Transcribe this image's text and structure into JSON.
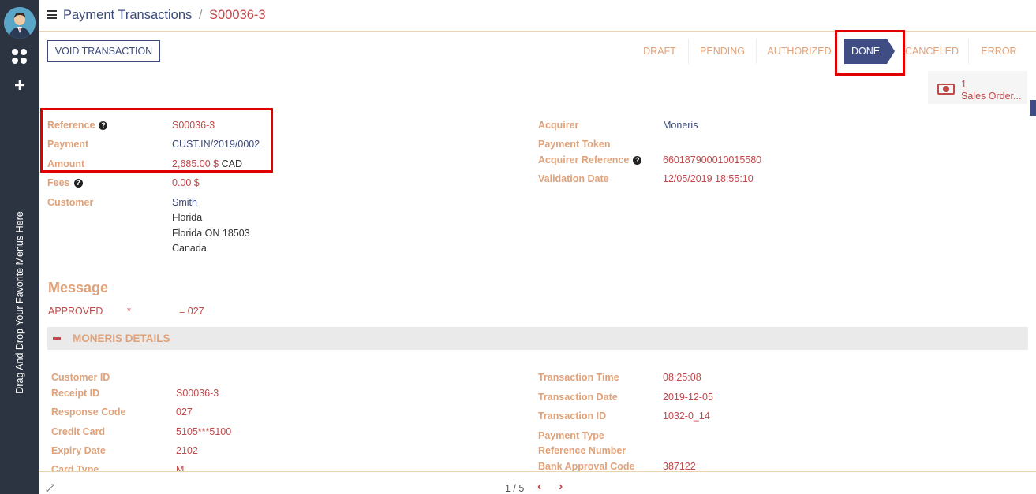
{
  "sidebar": {
    "favorite_hint": "Drag And Drop Your Favorite Menus Here"
  },
  "breadcrumb": {
    "parent": "Payment Transactions",
    "separator": "/",
    "current": "S00036-3"
  },
  "actions": {
    "void_label": "VOID TRANSACTION"
  },
  "status": {
    "stages": [
      "DRAFT",
      "PENDING",
      "AUTHORIZED",
      "DONE",
      "CANCELED",
      "ERROR"
    ],
    "active": "DONE"
  },
  "smart_button": {
    "count": "1",
    "label": "Sales Order..."
  },
  "fields_left": {
    "reference_label": "Reference",
    "reference_value": "S00036-3",
    "payment_label": "Payment",
    "payment_value": "CUST.IN/2019/0002",
    "amount_label": "Amount",
    "amount_value": "2,685.00 $",
    "amount_currency": "CAD",
    "fees_label": "Fees",
    "fees_value": "0.00 $",
    "customer_label": "Customer",
    "customer_name": "Smith",
    "customer_line1": "Florida",
    "customer_line2": "Florida ON 18503",
    "customer_line3": "Canada"
  },
  "fields_right": {
    "acquirer_label": "Acquirer",
    "acquirer_value": "Moneris",
    "payment_token_label": "Payment Token",
    "acquirer_reference_label": "Acquirer Reference",
    "acquirer_reference_value": "660187900010015580",
    "validation_date_label": "Validation Date",
    "validation_date_value": "12/05/2019 18:55:10"
  },
  "message": {
    "title": "Message",
    "status": "APPROVED",
    "star": "*",
    "code": "= 027"
  },
  "moneris": {
    "title": "MONERIS DETAILS",
    "left": [
      {
        "label": "Customer ID",
        "value": ""
      },
      {
        "label": "Receipt ID",
        "value": "S00036-3"
      },
      {
        "label": "Response Code",
        "value": "027"
      },
      {
        "label": "Credit Card",
        "value": "5105***5100"
      },
      {
        "label": "Expiry Date",
        "value": "2102"
      },
      {
        "label": "Card Type",
        "value": "M"
      }
    ],
    "right": [
      {
        "label": "Transaction Time",
        "value": "08:25:08"
      },
      {
        "label": "Transaction Date",
        "value": "2019-12-05"
      },
      {
        "label": "Transaction ID",
        "value": "1032-0_14"
      },
      {
        "label": "Payment Type",
        "value": ""
      },
      {
        "label": "Reference Number",
        "value": ""
      },
      {
        "label": "Bank Approval Code",
        "value": "387122"
      }
    ]
  },
  "pager": {
    "text": "1 / 5"
  }
}
